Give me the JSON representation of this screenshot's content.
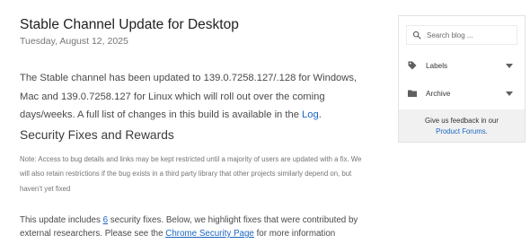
{
  "post": {
    "title": "Stable Channel Update for Desktop",
    "date": "Tuesday, August 12, 2025",
    "intro_text": "The Stable channel has been updated to 139.0.7258.127/.128 for Windows, Mac and 139.0.7258.127 for Linux which will roll out over the coming days/weeks. A full list of changes in this build is available in the ",
    "intro_link": "Log",
    "intro_end": ".",
    "section_heading": "Security Fixes and Rewards",
    "note": "Note: Access to bug details and links may be kept restricted until a majority of users are updated with a fix. We will also retain restrictions if the bug exists in a third party library that other projects similarly depend on, but haven’t yet fixed",
    "body_part1": "This update includes ",
    "fix_count": "6",
    "body_part2": " security fixes. Below, we highlight fixes that were contributed by external researchers. Please see the ",
    "security_link": "Chrome Security Page",
    "body_part3": " for more information"
  },
  "sidebar": {
    "search_placeholder": "Search blog ...",
    "search_icon": "search-icon",
    "labels": "Labels",
    "labels_icon": "label-tag-icon",
    "archive": "Archive",
    "archive_icon": "folder-icon",
    "feedback_line1": "Give us feedback in our",
    "feedback_link": "Product Forums",
    "feedback_end": "."
  },
  "colors": {
    "link": "#1a66c2",
    "muted": "#757575",
    "feedback_bg": "#f1f1f1"
  }
}
